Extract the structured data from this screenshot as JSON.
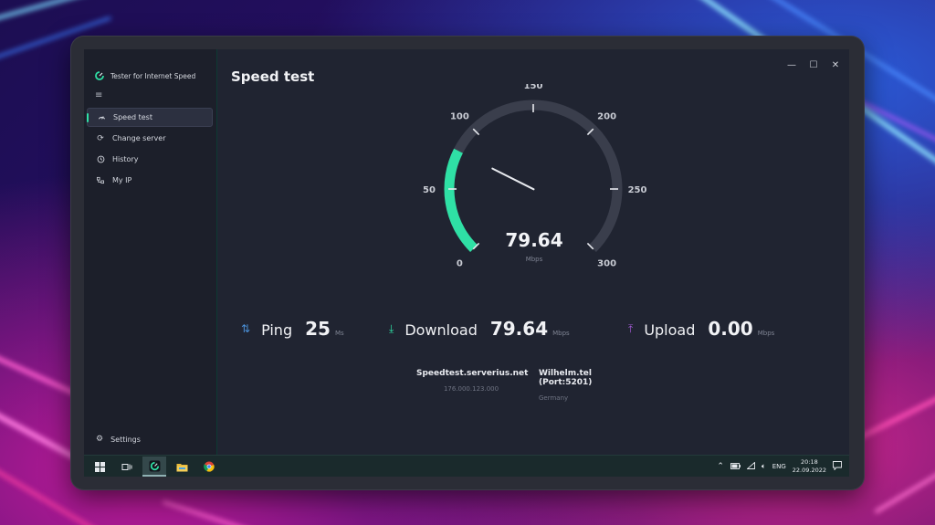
{
  "app": {
    "title": "Tester for Internet Speed"
  },
  "sidebar": {
    "items": [
      {
        "label": "Speed test",
        "icon": "speed-icon",
        "active": true
      },
      {
        "label": "Change server",
        "icon": "refresh-icon",
        "active": false
      },
      {
        "label": "History",
        "icon": "history-icon",
        "active": false
      },
      {
        "label": "My IP",
        "icon": "network-icon",
        "active": false
      }
    ],
    "settings_label": "Settings"
  },
  "main": {
    "title": "Speed test"
  },
  "gauge": {
    "value": 79.64,
    "value_text": "79.64",
    "unit": "Mbps",
    "min": 0,
    "max": 300,
    "ticks": [
      "0",
      "50",
      "100",
      "150",
      "200",
      "250",
      "300"
    ],
    "arc_fill_value": 80,
    "accent": "#2fe0a5",
    "track_color": "#3a3e4c"
  },
  "stats": {
    "ping": {
      "label": "Ping",
      "value": "25",
      "unit": "Ms",
      "icon": "arrows-updown-icon",
      "color": "#4a8fd6"
    },
    "download": {
      "label": "Download",
      "value": "79.64",
      "unit": "Mbps",
      "icon": "download-icon",
      "color": "#2fe0a5"
    },
    "upload": {
      "label": "Upload",
      "value": "0.00",
      "unit": "Mbps",
      "icon": "upload-icon",
      "color": "#a45bd6"
    }
  },
  "server": {
    "host": "Speedtest.serverius.net",
    "ip": "176.000.123.000",
    "provider": "Wilhelm.tel (Port:5201)",
    "country": "Germany"
  },
  "taskbar": {
    "language": "ENG",
    "time": "20:18",
    "date": "22.09.2022"
  }
}
